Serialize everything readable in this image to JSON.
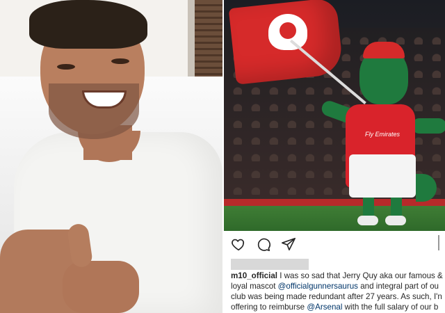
{
  "caption": {
    "username": "m10_official",
    "line1_text": " I was so sad that Jerry Quy aka our famous &",
    "line2_start": "loyal mascot ",
    "line2_mention": "@officialgunnersaurus",
    "line2_end": " and integral part of ou",
    "line3": "club was being made redundant after 27 years. As such, I'n",
    "line4_start": "offering to reimburse ",
    "line4_mention": "@Arsenal",
    "line4_end": " with the full salary of our b"
  },
  "mascot_shirt_text": "Fly Emirates",
  "colors": {
    "arsenal_red": "#d62a2a",
    "mascot_green": "#1f7a3e",
    "mention_blue": "#003569"
  },
  "icons": [
    "heart-icon",
    "comment-icon",
    "share-icon"
  ]
}
